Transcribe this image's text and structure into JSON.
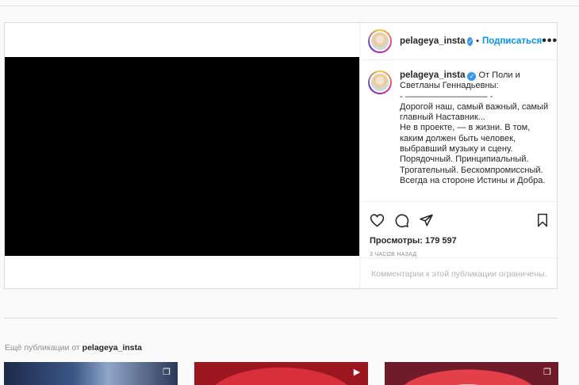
{
  "post": {
    "username": "pelageya_insta",
    "separator_dot": "•",
    "follow_label": "Подписаться",
    "more_label": "•••",
    "caption": {
      "username": "pelageya_insta",
      "lines": [
        "От Поли и Светланы Геннадьевны:",
        "- ––––––––––––––––– -",
        "Дорогой наш, самый важный, самый главный Наставник...",
        "Не в проекте, — в жизни. В том, каким должен быть человек, выбравший музыку и сцену.",
        "Порядочный. Принципиальный. Трогательный. Бескомпромиссный. Всегда на стороне Истины и Добра."
      ]
    },
    "views": "Просмотры: 179 597",
    "time": "3 часов назад",
    "comments_notice": "Комментарии к этой публикации ограничены."
  },
  "more_posts": {
    "prefix": "Ещё публикации от",
    "username": "pelageya_insta",
    "thumbs": [
      {
        "icon": "carousel-icon"
      },
      {
        "icon": "video-icon"
      },
      {
        "icon": "carousel-icon"
      }
    ]
  },
  "icons": [
    "like-icon",
    "comment-icon",
    "share-icon",
    "save-icon",
    "verified-icon",
    "more-options-icon"
  ],
  "colors": {
    "link_blue": "#0095f6",
    "verified_blue": "#3897f0",
    "border": "#dbdbdb",
    "muted": "#8e8e8e",
    "video_bg": "#000000"
  }
}
